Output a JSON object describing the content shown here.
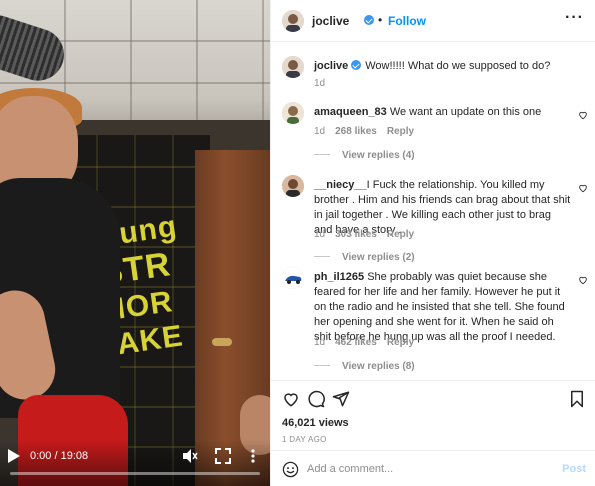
{
  "video": {
    "time_label": "0:00 / 19:08",
    "progress_fraction": 0.0,
    "banner_lines": [
      "Yung",
      "STR",
      "MOR",
      "TAKE"
    ]
  },
  "post": {
    "username": "joclive",
    "dot": "•",
    "follow_label": "Follow",
    "more_label": "···",
    "caption_username": "joclive",
    "caption_text": "Wow!!!!! What do we supposed to do?",
    "caption_time": "1d"
  },
  "comments": [
    {
      "username": "amaqueen_83",
      "text": "We want an update on this one",
      "time": "1d",
      "likes": "268 likes",
      "reply_label": "Reply",
      "view_replies": "View replies (4)",
      "avatar_color": "#8a6a4a"
    },
    {
      "username": "__niecy__",
      "text": "I Fuck the relationship. You killed my brother . Him and his friends can brag about that shit in jail together . We killing each other just to brag and have a story .",
      "time": "1d",
      "likes": "303 likes",
      "reply_label": "Reply",
      "view_replies": "View replies (2)",
      "avatar_color": "#6e4a36"
    },
    {
      "username": "ph_il1265",
      "text": "She probably was quiet because she feared for her life and her family. However he put it on the radio and he insisted that she tell. She found her opening and she went for it. When he said oh shit before he hung up was all the proof I needed.",
      "time": "1d",
      "likes": "462 likes",
      "reply_label": "Reply",
      "view_replies": "View replies (8)",
      "avatar_color": "#2255aa"
    }
  ],
  "actions": {
    "views": "46,021 views",
    "date": "1 DAY AGO"
  },
  "add_comment": {
    "placeholder": "Add a comment...",
    "post_label": "Post"
  },
  "colors": {
    "link_blue": "#0095f6",
    "verified_blue": "#3897f0",
    "muted_gray": "#8e8e8e",
    "post_disabled": "#b3dbff"
  }
}
